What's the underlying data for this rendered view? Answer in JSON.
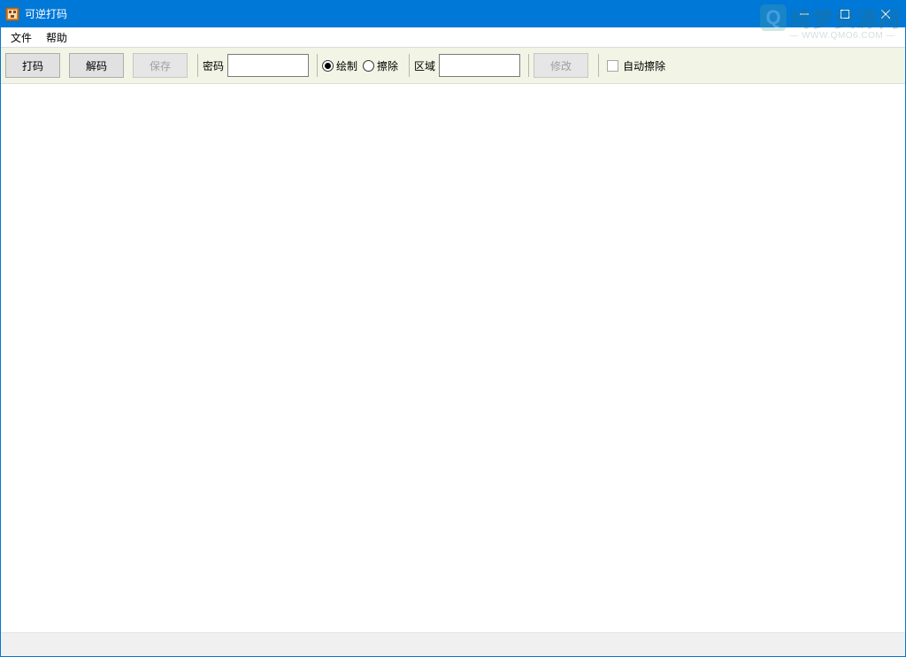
{
  "window": {
    "title": "可逆打码"
  },
  "menu": {
    "items": [
      "文件",
      "帮助"
    ]
  },
  "toolbar": {
    "btn_encode": "打码",
    "btn_decode": "解码",
    "btn_save": "保存",
    "label_password": "密码",
    "password_value": "",
    "radio_draw": "绘制",
    "radio_erase": "擦除",
    "radio_selected": "draw",
    "label_region": "区域",
    "region_value": "",
    "btn_modify": "修改",
    "checkbox_auto_erase": "自动擦除",
    "checkbox_auto_erase_checked": false
  },
  "watermark": {
    "logo_letter": "Q",
    "main": "绮梦资源网",
    "sub": "— WWW.QMO6.COM —"
  },
  "colors": {
    "titlebar": "#0078d7",
    "toolbar_bg": "#f2f4e5",
    "button_bg": "#e1e1e1",
    "button_border": "#adadad"
  }
}
